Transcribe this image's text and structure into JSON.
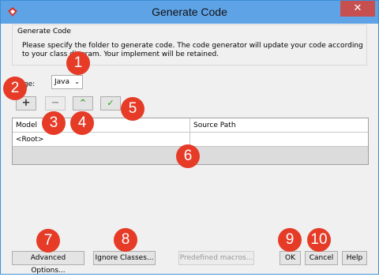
{
  "window": {
    "title": "Generate Code",
    "close_glyph": "✕"
  },
  "group": {
    "title": "Generate Code",
    "description": "Please specify the folder to generate code. The code generator will update your code according to your class diagram. Your implement will be retained."
  },
  "language": {
    "label": "guage:",
    "value": "Java"
  },
  "toolbar": {
    "add": "+",
    "remove": "−",
    "up": "^",
    "check": "✓"
  },
  "table": {
    "columns": [
      "Model",
      "Source Path"
    ],
    "rows": [
      {
        "model": "<Root>",
        "source_path": ""
      }
    ]
  },
  "buttons": {
    "advanced": "Advanced Options...",
    "ignore": "Ignore Classes...",
    "macros": "Predefined macros...",
    "ok": "OK",
    "cancel": "Cancel",
    "help": "Help"
  },
  "markers": [
    "1",
    "2",
    "3",
    "4",
    "5",
    "6",
    "7",
    "8",
    "9",
    "10"
  ],
  "colors": {
    "titlebar": "#5fa3e7",
    "close": "#c64f4f",
    "marker": "#e53b27",
    "accent_green": "#2a9d1e"
  }
}
